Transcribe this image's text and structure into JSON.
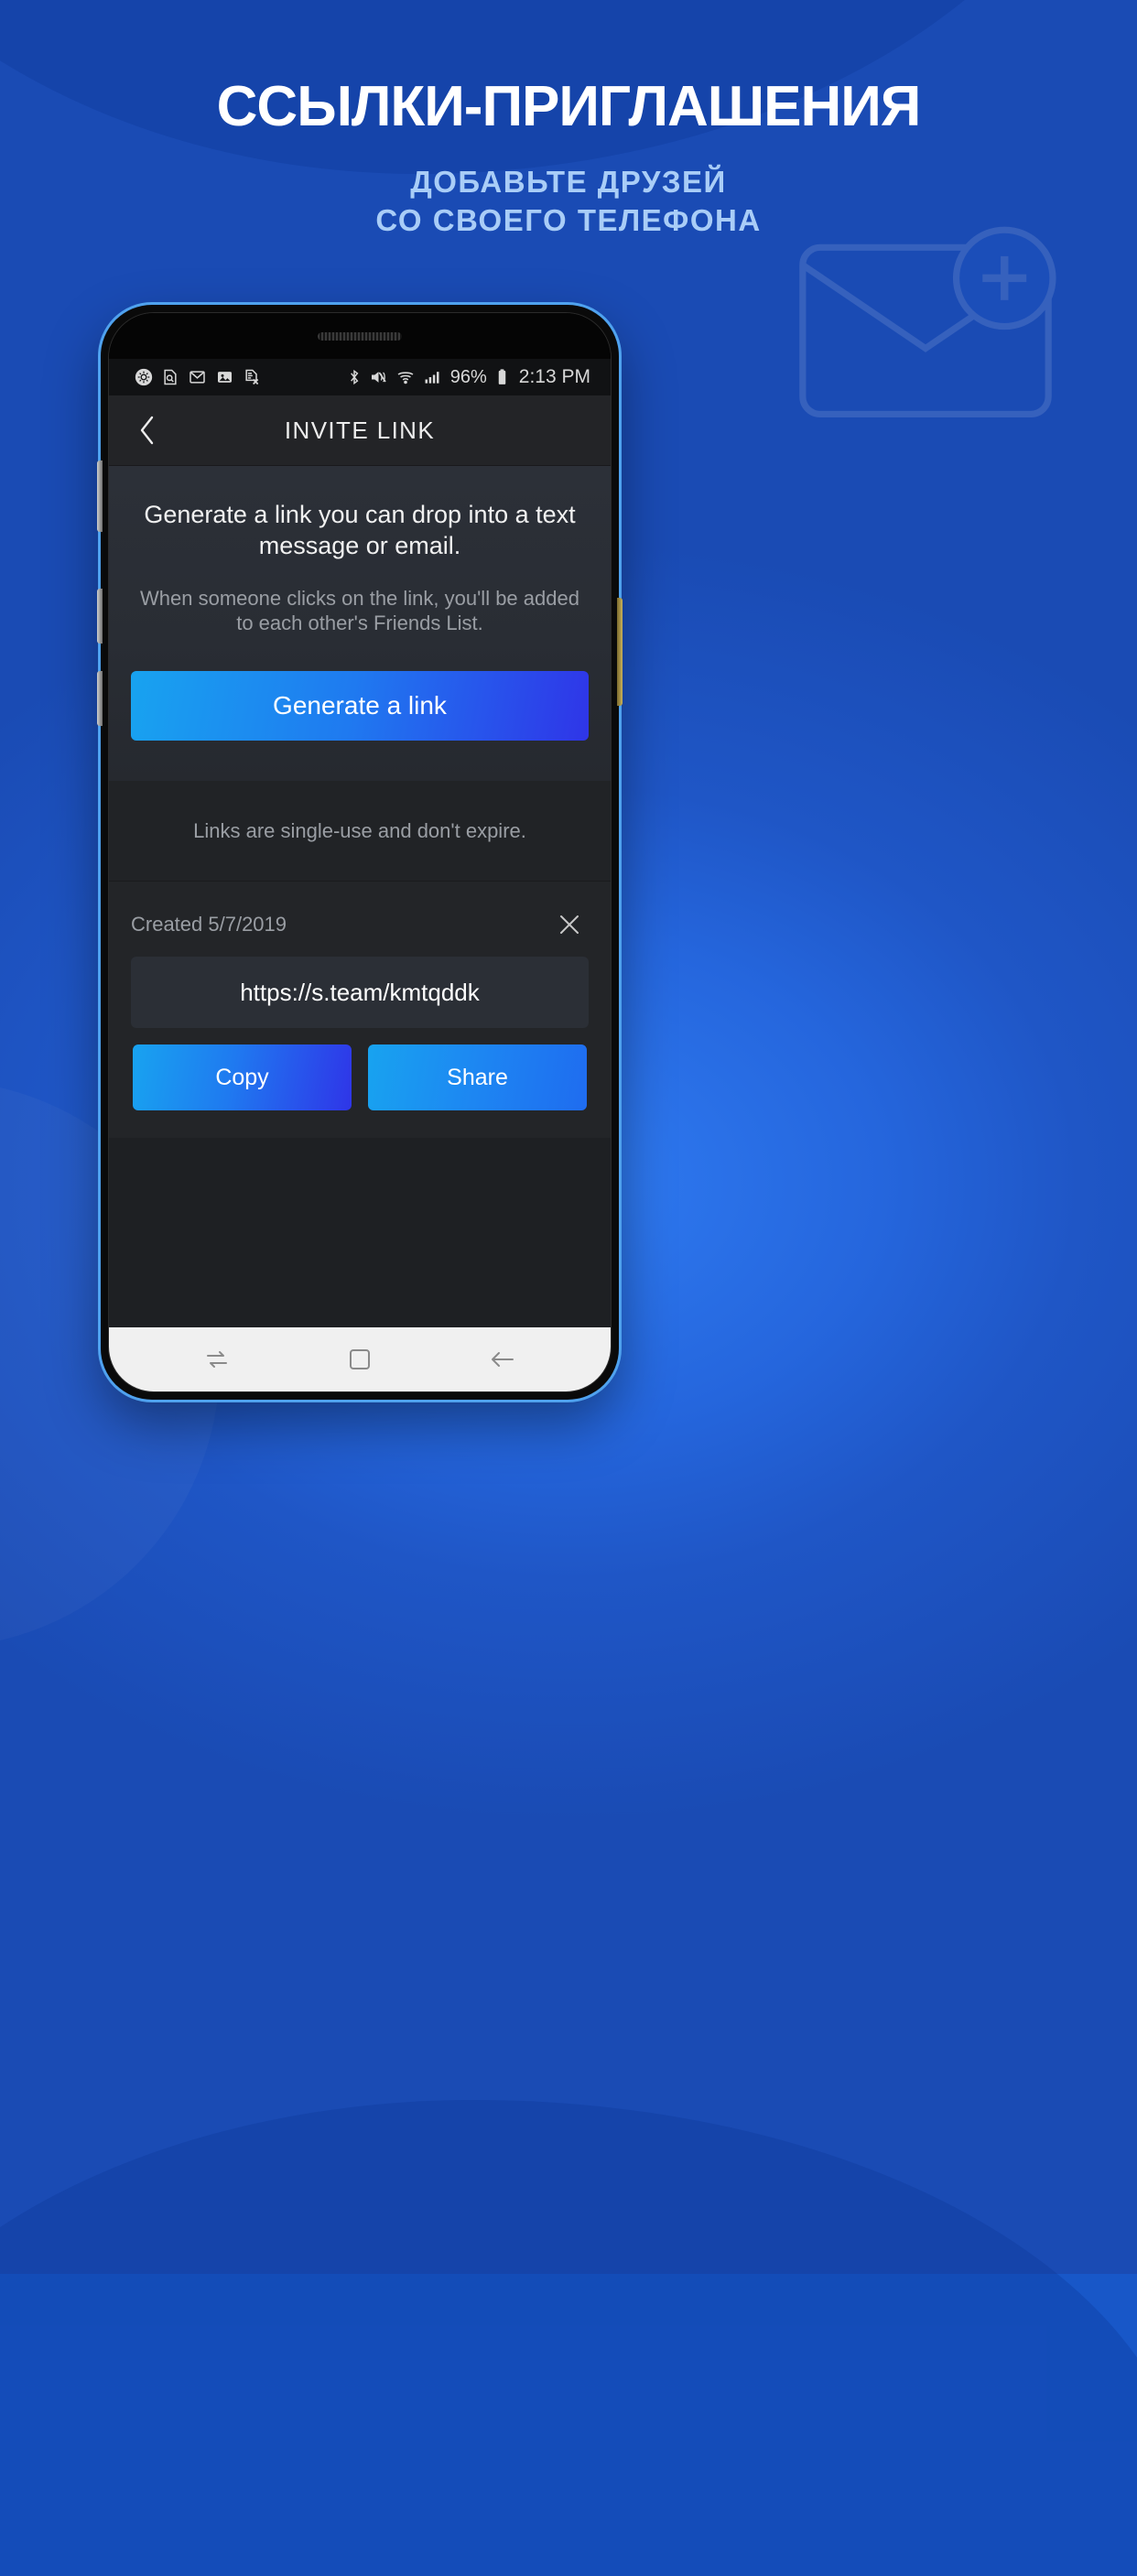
{
  "promo": {
    "title": "ССЫЛКИ-ПРИГЛАШЕНИЯ",
    "subtitle_line1": "ДОБАВЬТЕ ДРУЗЕЙ",
    "subtitle_line2": "СО СВОЕГО ТЕЛЕФОНА",
    "background_color": "#2566dd",
    "title_color": "#ffffff",
    "subtitle_color": "#a9cdf7",
    "watermark_icon": "envelope-plus-icon"
  },
  "statusbar": {
    "left_icons": [
      "gear-icon",
      "document-search-icon",
      "gmail-icon",
      "photo-icon",
      "file-remove-icon"
    ],
    "right_icons": [
      "bluetooth-icon",
      "volume-mute-icon",
      "wifi-icon",
      "cellular-signal-icon"
    ],
    "battery_percent": "96%",
    "battery_icon": "battery-full-icon",
    "clock": "2:13 PM"
  },
  "appbar": {
    "back_icon": "back-chevron-icon",
    "title": "INVITE LINK"
  },
  "main": {
    "lead_text": "Generate a link you can drop into a text message or email.",
    "sub_text": "When someone clicks on the link, you'll be added to each other's Friends List.",
    "generate_button": "Generate a link",
    "note": "Links are single-use and don't expire.",
    "accent_start": "#18a3f0",
    "accent_end": "#2f35e8"
  },
  "link_card": {
    "created_label": "Created 5/7/2019",
    "close_icon": "close-x-icon",
    "url": "https://s.team/kmtqddk",
    "copy_button": "Copy",
    "share_button": "Share"
  },
  "navbar": {
    "recents_icon": "recents-icon",
    "home_icon": "home-square-icon",
    "back_icon": "back-arrow-icon"
  }
}
